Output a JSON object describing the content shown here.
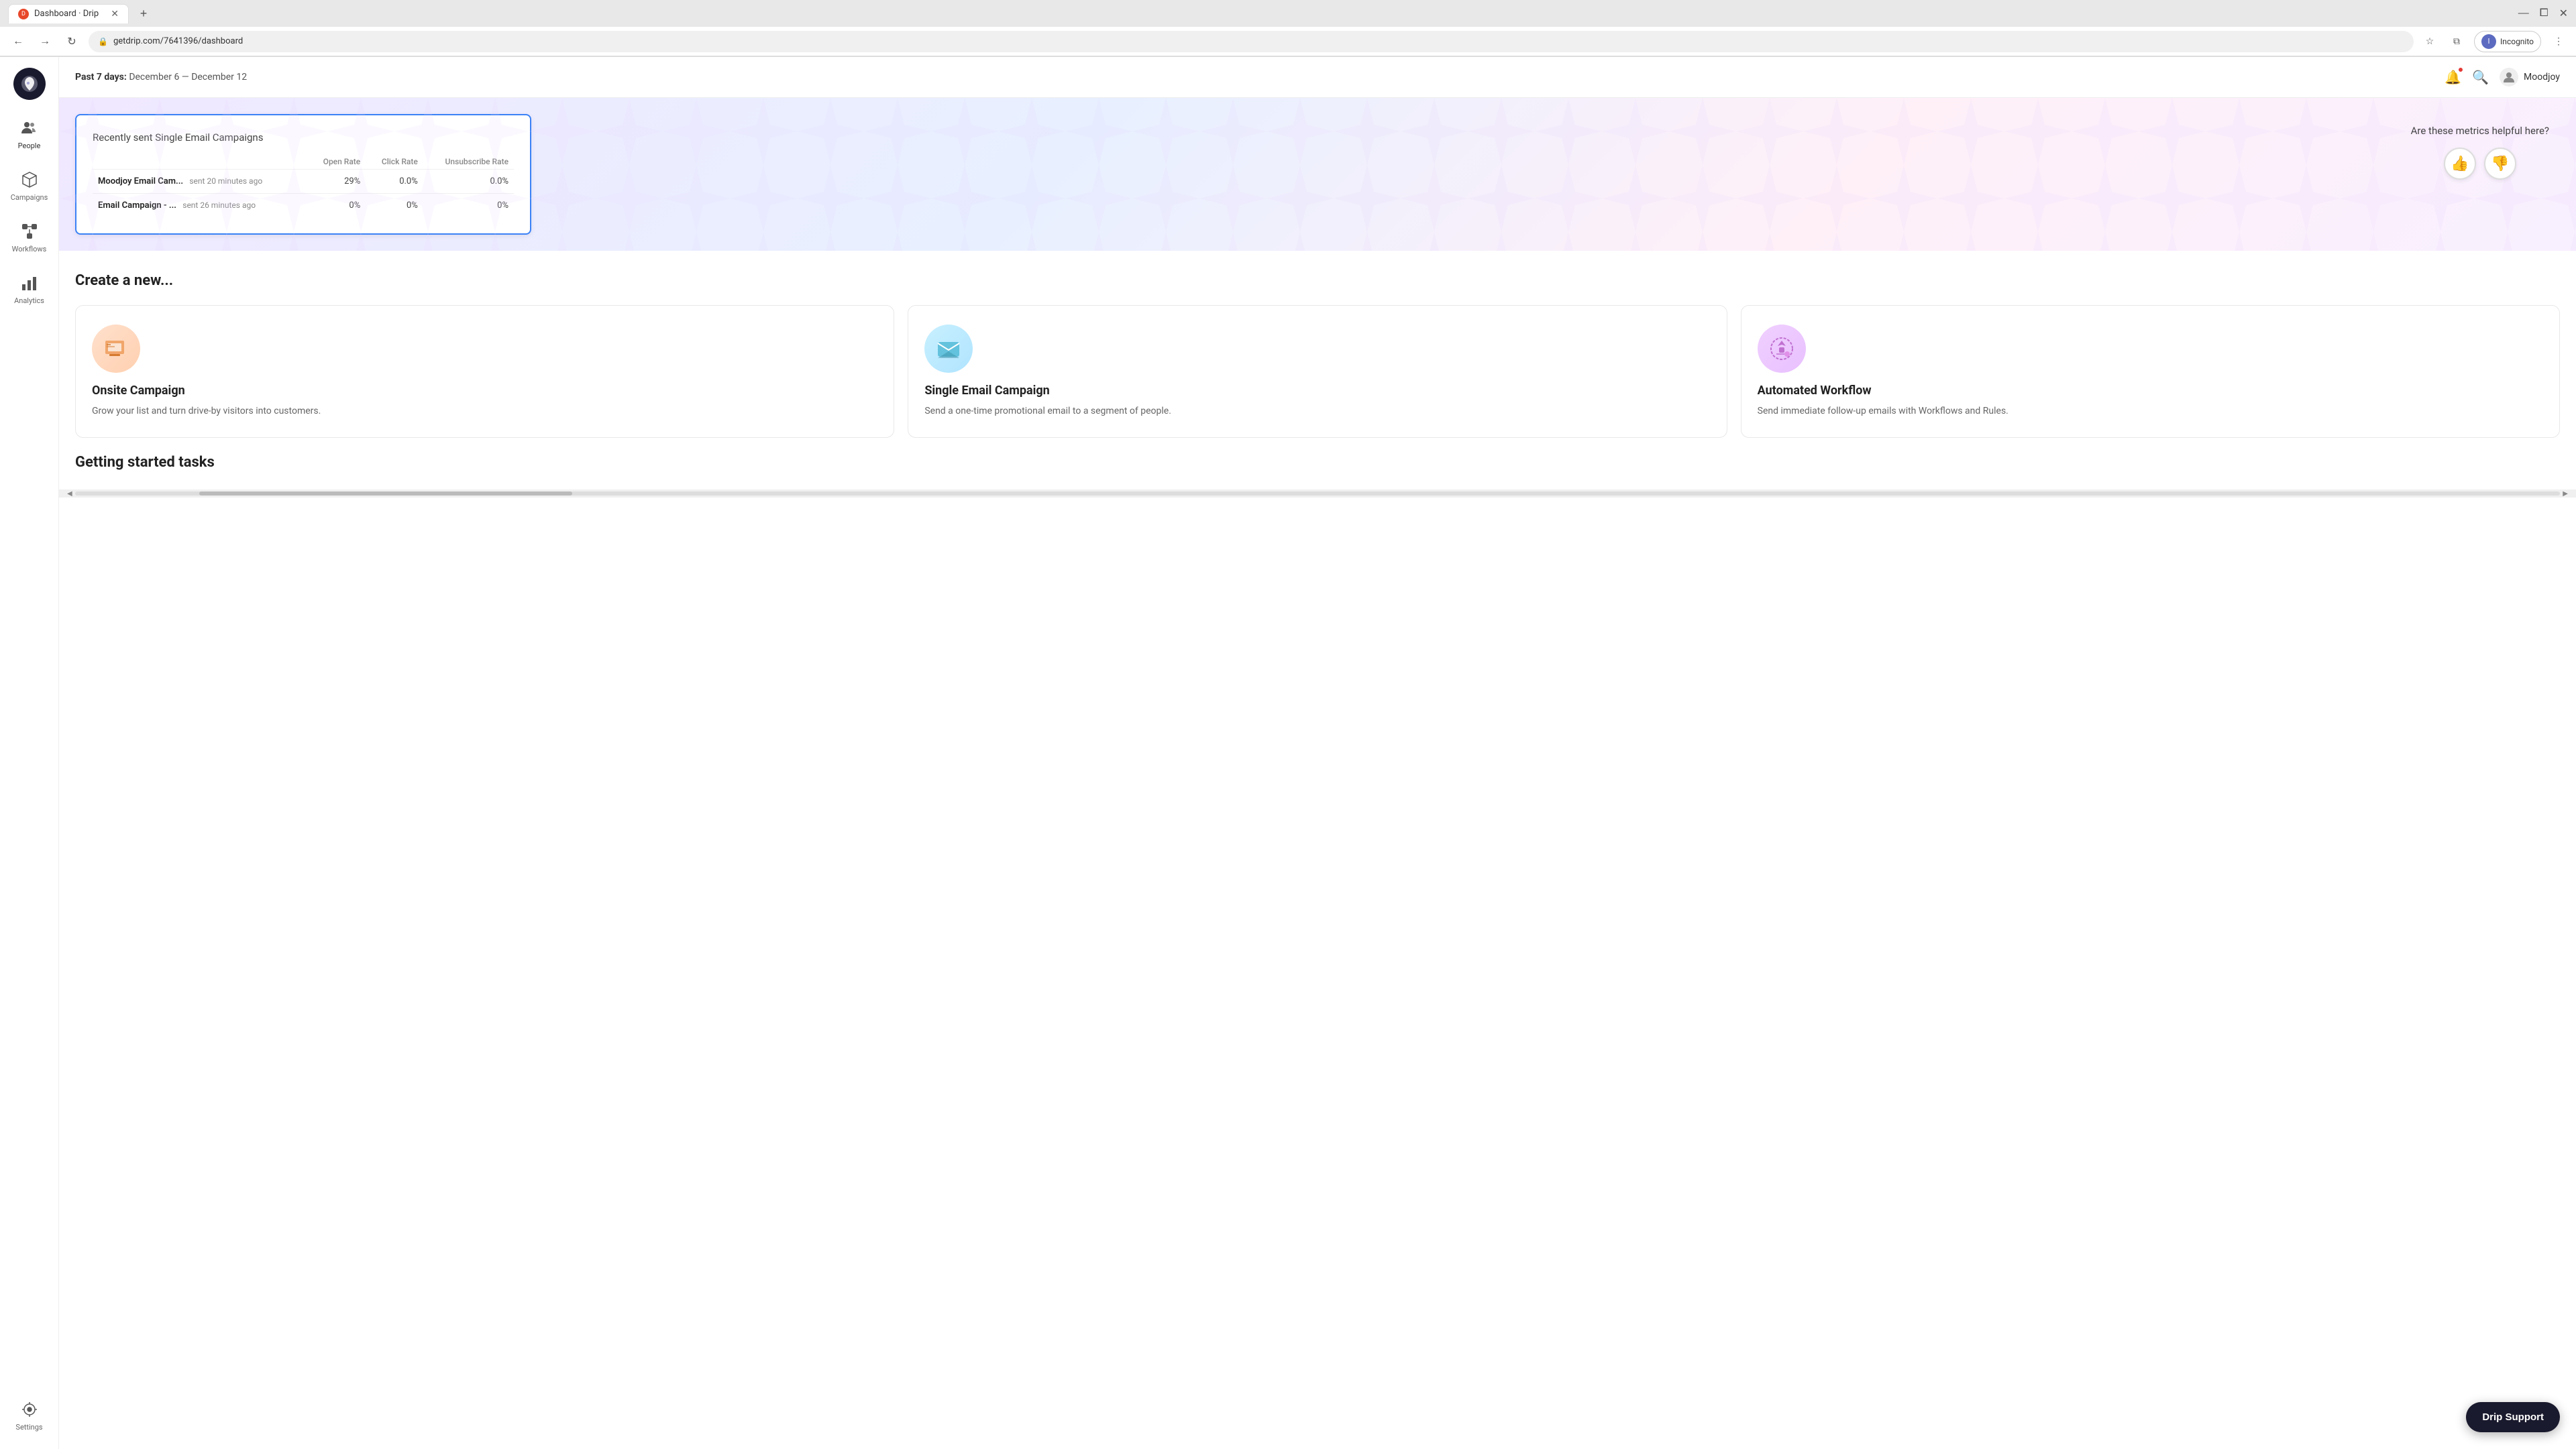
{
  "browser": {
    "tab_title": "Dashboard · Drip",
    "url": "getdrip.com/7641396/dashboard",
    "user_label": "Incognito",
    "new_tab_icon": "+"
  },
  "header": {
    "date_label": "Past 7 days:",
    "date_range": "December 6 — December 12",
    "user_name": "Moodjoy"
  },
  "sidebar": {
    "logo_alt": "Drip logo",
    "items": [
      {
        "id": "people",
        "label": "People"
      },
      {
        "id": "campaigns",
        "label": "Campaigns"
      },
      {
        "id": "workflows",
        "label": "Workflows"
      },
      {
        "id": "analytics",
        "label": "Analytics"
      },
      {
        "id": "settings",
        "label": "Settings"
      }
    ]
  },
  "campaigns_table": {
    "title": "Recently sent Single Email Campaigns",
    "columns": [
      "Open Rate",
      "Click Rate",
      "Unsubscribe Rate"
    ],
    "rows": [
      {
        "name": "Moodjoy Email Cam...",
        "time": "sent 20 minutes ago",
        "open_rate": "29%",
        "click_rate": "0.0%",
        "unsubscribe_rate": "0.0%"
      },
      {
        "name": "Email Campaign - ...",
        "time": "sent 26 minutes ago",
        "open_rate": "0%",
        "click_rate": "0%",
        "unsubscribe_rate": "0%"
      }
    ]
  },
  "metrics_feedback": {
    "question": "Are these metrics helpful here?",
    "thumbs_up": "👍",
    "thumbs_down": "👎"
  },
  "create_section": {
    "title": "Create a new...",
    "cards": [
      {
        "id": "onsite",
        "title": "Onsite Campaign",
        "description": "Grow your list and turn drive-by visitors into customers."
      },
      {
        "id": "single-email",
        "title": "Single Email Campaign",
        "description": "Send a one-time promotional email to a segment of people."
      },
      {
        "id": "workflow",
        "title": "Automated Workflow",
        "description": "Send immediate follow-up emails with Workflows and Rules."
      }
    ]
  },
  "getting_started": {
    "title": "Getting started tasks"
  },
  "support_button": {
    "label": "Drip Support"
  }
}
